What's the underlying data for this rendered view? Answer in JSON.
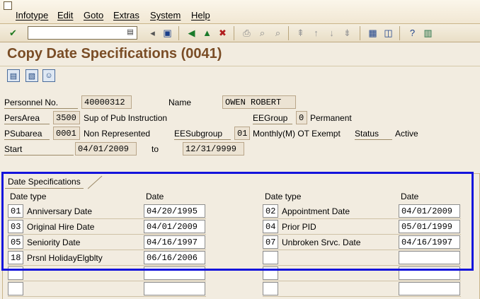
{
  "menu": [
    "Infotype",
    "Edit",
    "Goto",
    "Extras",
    "System",
    "Help"
  ],
  "title": "Copy Date Specifications (0041)",
  "header": {
    "personnel_no_label": "Personnel No.",
    "personnel_no": "40000312",
    "name_label": "Name",
    "name": "OWEN ROBERT",
    "persarea_label": "PersArea",
    "persarea_code": "3500",
    "persarea_text": "Sup of Pub Instruction",
    "eegroup_label": "EEGroup",
    "eegroup_code": "0",
    "eegroup_text": "Permanent",
    "psubarea_label": "PSubarea",
    "psubarea_code": "0001",
    "psubarea_text": "Non Represented",
    "eesubgroup_label": "EESubgroup",
    "eesubgroup_code": "01",
    "eesubgroup_text": "Monthly(M) OT Exempt",
    "status_label": "Status",
    "status_value": "Active",
    "start_label": "Start",
    "start_date": "04/01/2009",
    "to_label": "to",
    "end_date": "12/31/9999"
  },
  "section": {
    "title": "Date Specifications",
    "col_datetype": "Date type",
    "col_date": "Date",
    "left": [
      {
        "code": "01",
        "text": "Anniversary Date",
        "date": "04/20/1995"
      },
      {
        "code": "03",
        "text": "Original Hire Date",
        "date": "04/01/2009"
      },
      {
        "code": "05",
        "text": "Seniority Date",
        "date": "04/16/1997"
      },
      {
        "code": "18",
        "text": "Prsnl HolidayElgblty",
        "date": "06/16/2006"
      },
      {
        "code": "",
        "text": "",
        "date": ""
      },
      {
        "code": "",
        "text": "",
        "date": ""
      }
    ],
    "right": [
      {
        "code": "02",
        "text": "Appointment Date",
        "date": "04/01/2009"
      },
      {
        "code": "04",
        "text": "Prior PID",
        "date": "05/01/1999"
      },
      {
        "code": "07",
        "text": "Unbroken Srvc. Date",
        "date": "04/16/1997"
      },
      {
        "code": "",
        "text": "",
        "date": ""
      },
      {
        "code": "",
        "text": "",
        "date": ""
      },
      {
        "code": "",
        "text": "",
        "date": ""
      }
    ]
  },
  "colors": {
    "title": "#7a4d26",
    "highlight": "#1414dc"
  }
}
